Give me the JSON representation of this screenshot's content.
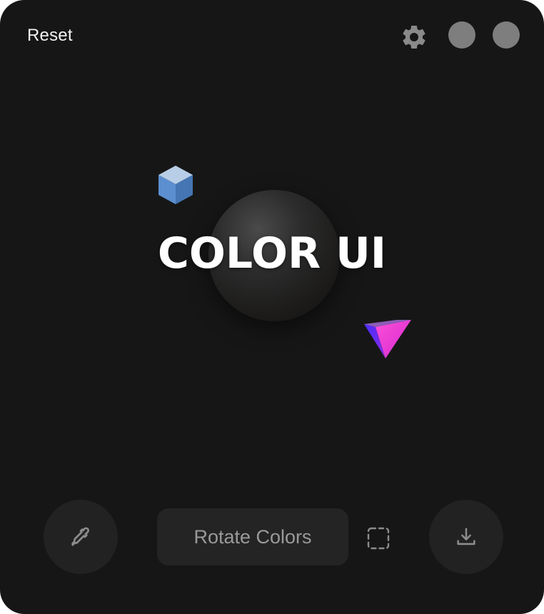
{
  "header": {
    "reset_label": "Reset",
    "settings_icon": "gear-icon"
  },
  "stage": {
    "title": "COLOR UI",
    "shapes": [
      {
        "name": "cube",
        "color": "#5b8fd0"
      },
      {
        "name": "sphere",
        "color": "#2a2a2a"
      },
      {
        "name": "pyramid",
        "color": "#c83cff"
      }
    ]
  },
  "toolbar": {
    "picker_icon": "eyedropper-icon",
    "rotate_label": "Rotate Colors",
    "select_icon": "dashed-selection-icon",
    "download_icon": "download-icon"
  },
  "colors": {
    "background": "#161616",
    "button_bg": "#222222",
    "accent_blue": "#5b8fd0",
    "accent_magenta": "#e23ad8",
    "accent_violet": "#6a3cff"
  }
}
